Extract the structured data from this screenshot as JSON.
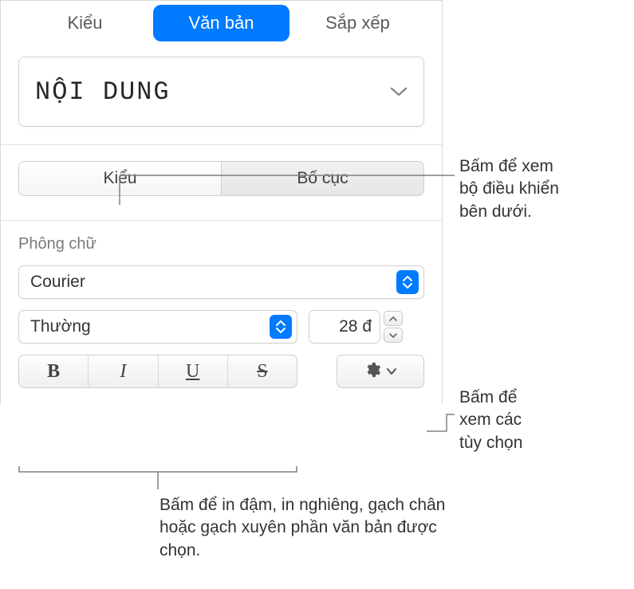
{
  "top_tabs": {
    "style": "Kiểu",
    "text": "Văn bản",
    "arrange": "Sắp xếp"
  },
  "paragraph_style": {
    "name": "NỘI DUNG"
  },
  "sub_tabs": {
    "style": "Kiểu",
    "layout": "Bố cục"
  },
  "font_section": {
    "label": "Phông chữ",
    "family": "Courier",
    "style": "Thường",
    "size": "28 đ"
  },
  "style_buttons": {
    "bold": "B",
    "italic": "I",
    "underline": "U",
    "strike": "S"
  },
  "callouts": {
    "sub_tab_hint": "Bấm để xem\nbộ điều khiển\nbên dưới.",
    "gear_hint": "Bấm để\nxem các\ntùy chọn",
    "style_btn_hint": "Bấm để in đậm, in nghiêng, gạch chân hoặc gạch xuyên phần văn bản được chọn."
  }
}
